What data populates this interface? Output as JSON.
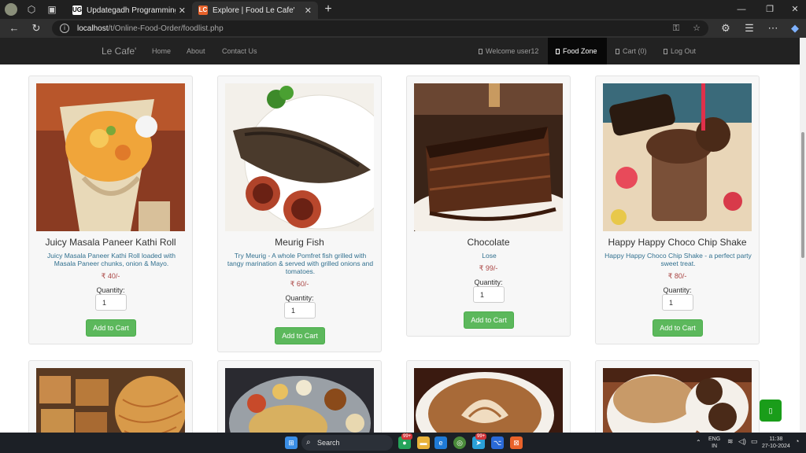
{
  "browser": {
    "tabs": [
      {
        "label": "Updategadh Programming - Upd",
        "favicon": "UG"
      },
      {
        "label": "Explore | Food Le Cafe'",
        "favicon": "LC"
      }
    ],
    "url_host": "localhost",
    "url_path": "/t/Online-Food-Order/foodlist.php"
  },
  "navbar": {
    "brand": "Le Cafe'",
    "links": [
      "Home",
      "About",
      "Contact Us"
    ],
    "right": [
      "Welcome user12",
      "Food Zone",
      "Cart (0)",
      "Log Out"
    ],
    "active": "Food Zone"
  },
  "labels": {
    "quantity": "Quantity:",
    "add_to_cart": "Add to Cart"
  },
  "products": [
    {
      "name": "Juicy Masala Paneer Kathi Roll",
      "desc": "Juicy Masala Paneer Kathi Roll loaded with Masala Paneer chunks, onion & Mayo.",
      "price": "₹ 40/-",
      "qty": "1"
    },
    {
      "name": "Meurig Fish",
      "desc": "Try Meurig - A whole Pomfret fish grilled with tangy marination & served with grilled onions and tomatoes.",
      "price": "₹ 60/-",
      "qty": "1"
    },
    {
      "name": "Chocolate",
      "desc": "Lose",
      "price": "₹ 99/-",
      "qty": "1"
    },
    {
      "name": "Happy Happy Choco Chip Shake",
      "desc": "Happy Happy Choco Chip Shake - a perfect party sweet treat.",
      "price": "₹ 80/-",
      "qty": "1"
    }
  ],
  "taskbar": {
    "search": "Search",
    "badge1": "99+",
    "badge2": "99+",
    "lang": "ENG",
    "region": "IN",
    "time": "11:38",
    "date": "27-10-2024"
  },
  "colors": {
    "navbar": "#222222",
    "button": "#5cb85c",
    "description": "#31708f",
    "price": "#a94442"
  }
}
